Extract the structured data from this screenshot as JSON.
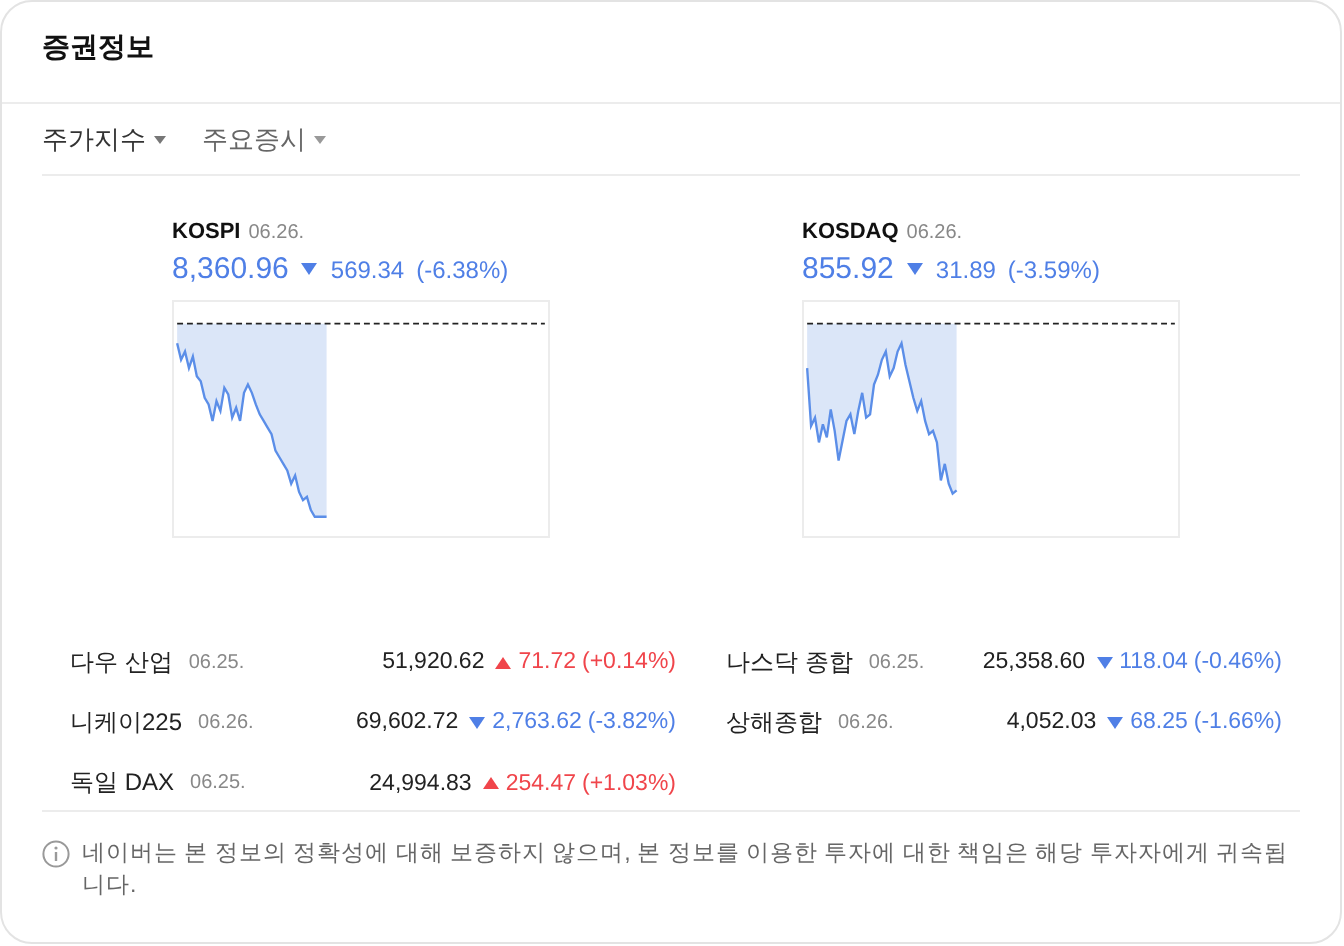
{
  "title": "증권정보",
  "tabs": [
    {
      "label": "주가지수",
      "selected": true
    },
    {
      "label": "주요증시",
      "selected": false
    }
  ],
  "indices": [
    {
      "name": "KOSPI",
      "date": "06.26.",
      "value": "8,360.96",
      "kind": "down",
      "change": "569.34",
      "percent": "(-6.38%)"
    },
    {
      "name": "KOSDAQ",
      "date": "06.26.",
      "value": "855.92",
      "kind": "down",
      "change": "31.89",
      "percent": "(-3.59%)"
    }
  ],
  "markets": [
    {
      "name": "다우 산업",
      "date": "06.25.",
      "value": "51,920.62",
      "kind": "up",
      "change": "71.72",
      "percent": "(+0.14%)"
    },
    {
      "name": "나스닥 종합",
      "date": "06.25.",
      "value": "25,358.60",
      "kind": "down",
      "change": "118.04",
      "percent": "(-0.46%)"
    },
    {
      "name": "니케이225",
      "date": "06.26.",
      "value": "69,602.72",
      "kind": "down",
      "change": "2,763.62",
      "percent": "(-3.82%)"
    },
    {
      "name": "상해종합",
      "date": "06.26.",
      "value": "4,052.03",
      "kind": "down",
      "change": "68.25",
      "percent": "(-1.66%)"
    },
    {
      "name": "독일 DAX",
      "date": "06.25.",
      "value": "24,994.83",
      "kind": "up",
      "change": "254.47",
      "percent": "(+1.03%)"
    }
  ],
  "notice": "네이버는 본 정보의 정확성에 대해 보증하지 않으며, 본 정보를 이용한 투자에 대한 책임은 해당 투자자에게 귀속됩니다."
}
